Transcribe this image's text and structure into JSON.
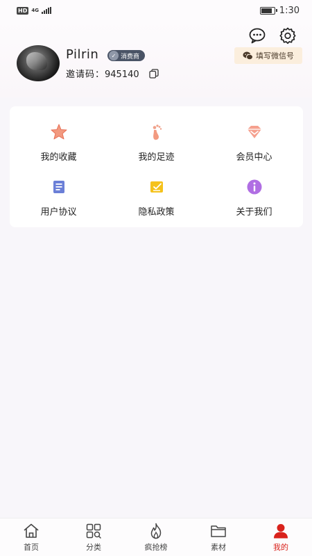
{
  "status_bar": {
    "hd": "HD",
    "network": "4G",
    "time": "1:30"
  },
  "profile": {
    "username": "Pilrin",
    "badge": "消费商",
    "invite_label": "邀请码：",
    "invite_code": "945140",
    "wechat_button": "填写微信号"
  },
  "menu": [
    {
      "label": "我的收藏",
      "icon": "star-icon"
    },
    {
      "label": "我的足迹",
      "icon": "footprint-icon"
    },
    {
      "label": "会员中心",
      "icon": "diamond-icon"
    },
    {
      "label": "用户协议",
      "icon": "document-icon"
    },
    {
      "label": "隐私政策",
      "icon": "policy-icon"
    },
    {
      "label": "关于我们",
      "icon": "info-icon"
    }
  ],
  "tabbar": [
    {
      "label": "首页",
      "icon": "home-icon",
      "active": false
    },
    {
      "label": "分类",
      "icon": "category-icon",
      "active": false
    },
    {
      "label": "疯抢榜",
      "icon": "flame-icon",
      "active": false
    },
    {
      "label": "素材",
      "icon": "folder-icon",
      "active": false
    },
    {
      "label": "我的",
      "icon": "user-icon",
      "active": true
    }
  ],
  "colors": {
    "accent": "#d9221c",
    "badge_bg": "#4a5466",
    "wechat_bg": "#fbeedd",
    "page_bg": "#f8f6fa"
  }
}
